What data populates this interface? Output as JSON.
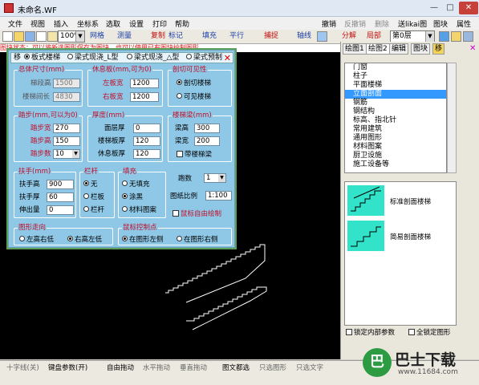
{
  "window": {
    "title": "未命名.WF",
    "min": "—",
    "max": "□",
    "close": "✕"
  },
  "menu": {
    "file": "文件",
    "view": "视图",
    "insert": "插入",
    "coord": "坐标系",
    "select": "选取",
    "settings": "设置",
    "print": "打印",
    "help": "帮助",
    "undo": "撤销",
    "redo": "反撤销",
    "delete": "删除",
    "send_drawing": "送likai图",
    "block": "图块",
    "props": "属性"
  },
  "toolbar": {
    "zoom": "100%",
    "grid": "网格",
    "measure": "测量",
    "copy": "复制",
    "label": "标记",
    "fill": "填充",
    "parallel": "平行",
    "snap": "捕捉",
    "axis": "轴线",
    "split": "分解",
    "local": "局部",
    "layer": "第0层"
  },
  "hint": "图块状态：可以将新选图形保存为图块，也可以使用已有图块绘制图形",
  "dialog": {
    "tabs": {
      "move": "移",
      "board_stair": "板式楼梯",
      "beam_stair_1": "梁式现浇_L型",
      "beam_stair_2": "梁式现浇_△型",
      "beam_stair_3": "梁式预制",
      "close": "✕"
    },
    "overall": {
      "title": "总体尺寸(mm)",
      "stair_height_label": "梯段高",
      "stair_height": "1500",
      "stair_length_label": "楼梯间长",
      "stair_length": "4830"
    },
    "rest": {
      "title": "休息板(mm,可为0)",
      "left_label": "左板宽",
      "left": "1200",
      "right_label": "右板宽",
      "right": "1200"
    },
    "section": {
      "title": "剖切可见性",
      "cut": "剖切楼梯",
      "visible": "可见楼梯"
    },
    "step": {
      "title": "踏步(mm,可以为0)",
      "width_label": "踏步宽",
      "width": "270",
      "height_label": "踏步高",
      "height": "150",
      "count_label": "踏步数",
      "count": "10"
    },
    "thickness": {
      "title": "厚度(mm)",
      "floor_label": "面层厚",
      "floor": "0",
      "stair_label": "楼梯板厚",
      "stair": "120",
      "rest_label": "休息板厚",
      "rest": "120"
    },
    "beam": {
      "title": "楼梯梁(mm)",
      "width_label": "梁高",
      "width": "300",
      "depth_label": "梁宽",
      "depth": "200",
      "check": "带楼梯梁"
    },
    "handrail": {
      "title": "扶手(mm)",
      "height_label": "扶手高",
      "height": "900",
      "thick_label": "扶手厚",
      "thick": "60",
      "extend_label": "伸出量",
      "extend": "0"
    },
    "railing": {
      "title": "栏杆",
      "none": "无",
      "plate": "栏板",
      "bar": "栏杆"
    },
    "fill": {
      "title": "填充",
      "none": "无填充",
      "black": "涂黑",
      "material": "材料图案"
    },
    "runs": {
      "label": "跑数",
      "value": "1",
      "scale_label": "图纸比例",
      "scale": "1:100",
      "mouse": "鼠标自由绘制"
    },
    "direction": {
      "title": "图形走向",
      "left_low": "左高右低",
      "right_low": "右高左低"
    },
    "mouse_ctrl": {
      "title": "鼠标控制点",
      "left": "在图形左侧",
      "right": "在图形右侧"
    }
  },
  "right_panel": {
    "tabs": [
      "绘图1",
      "绘图2",
      "编辑",
      "图块",
      "移"
    ],
    "list": [
      "门窗",
      "柱子",
      "平面楼梯",
      "立面剖面",
      "钢筋",
      "钢结构",
      "标高、指北针",
      "常用建筑",
      "通用图形",
      "材料图案",
      "厨卫设施",
      "施工设备等"
    ],
    "selected": "立面剖面",
    "previews": [
      {
        "label": "标准剖面楼梯"
      },
      {
        "label": "简易剖面楼梯"
      }
    ],
    "lock_internal": "锁定内部参数",
    "lock_all": "全锁定图形"
  },
  "status": {
    "cross": "十字线(关)",
    "keyboard": "键盘参数(开)",
    "free_drag": "自由拖动",
    "h_drag": "水平拖动",
    "v_drag": "垂直拖动",
    "graphic_text": "图文都选",
    "only_graphic": "只选图形",
    "only_text": "只选文字"
  },
  "watermark": {
    "glyph": "巴",
    "name": "巴士下载",
    "url": "www.11684.com"
  },
  "colors": {
    "dialog_bg": "#8fc7e6",
    "group_title": "#c0102a",
    "canvas": "#000000",
    "selection": "#3399ff",
    "thumb": "#33e3c9"
  }
}
